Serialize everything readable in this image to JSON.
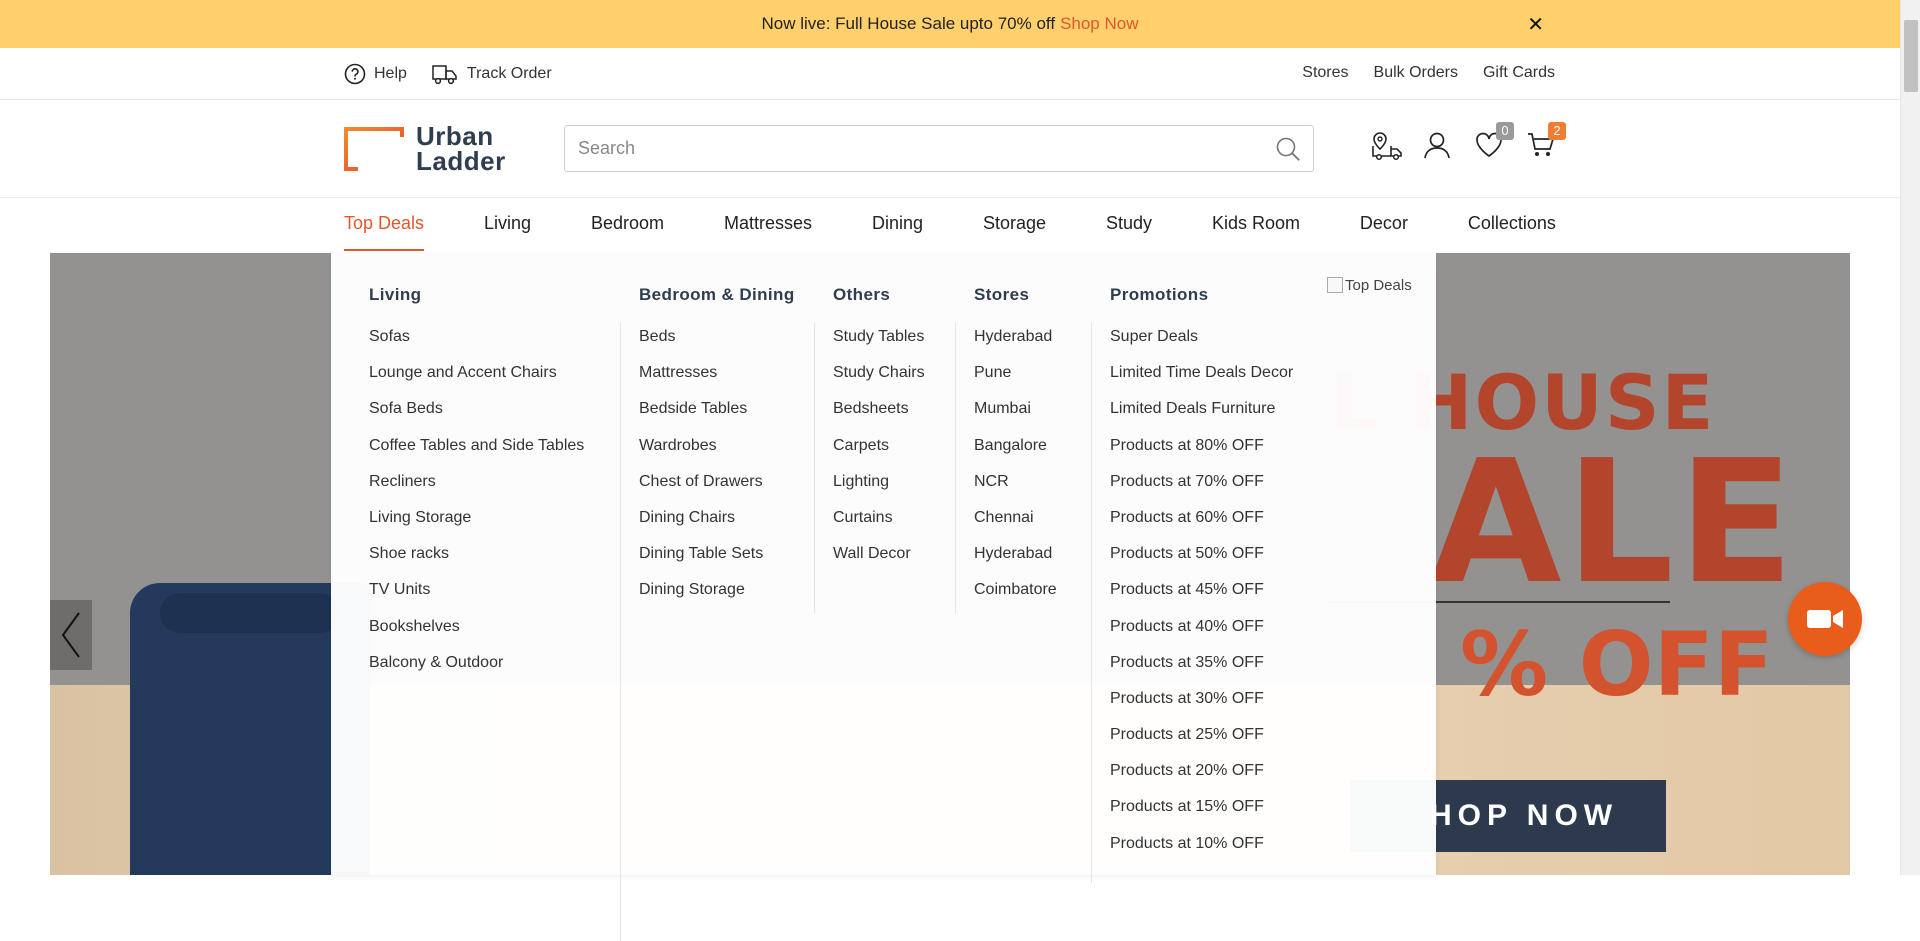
{
  "promo": {
    "text": "Now live: Full House Sale upto 70% off",
    "link": "Shop Now",
    "close": "✕"
  },
  "util": {
    "help": "Help",
    "track": "Track Order",
    "right": [
      "Stores",
      "Bulk Orders",
      "Gift Cards"
    ]
  },
  "header": {
    "logo_line1": "Urban",
    "logo_line2": "Ladder",
    "search_placeholder": "Search",
    "wishlist_count": "0",
    "cart_count": "2"
  },
  "nav": [
    "Top Deals",
    "Living",
    "Bedroom",
    "Mattresses",
    "Dining",
    "Storage",
    "Study",
    "Kids Room",
    "Decor",
    "Collections"
  ],
  "mega": {
    "living": {
      "title": "Living",
      "items": [
        "Sofas",
        "Lounge and Accent Chairs",
        "Sofa Beds",
        "Coffee Tables and Side Tables",
        "Recliners",
        "Living Storage",
        "Shoe racks",
        "TV Units",
        "Bookshelves",
        "Balcony & Outdoor"
      ]
    },
    "bedroom_dining": {
      "title": "Bedroom & Dining",
      "items": [
        "Beds",
        "Mattresses",
        "Bedside Tables",
        "Wardrobes",
        "Chest of Drawers",
        "Dining Chairs",
        "Dining Table Sets",
        "Dining Storage"
      ]
    },
    "others": {
      "title": "Others",
      "items": [
        "Study Tables",
        "Study Chairs",
        "Bedsheets",
        "Carpets",
        "Lighting",
        "Curtains",
        "Wall Decor"
      ]
    },
    "stores": {
      "title": "Stores",
      "items": [
        "Hyderabad",
        "Pune",
        "Mumbai",
        "Bangalore",
        "NCR",
        "Chennai",
        "Hyderabad",
        "Coimbatore"
      ]
    },
    "promotions": {
      "title": "Promotions",
      "items": [
        "Super Deals",
        "Limited Time Deals Decor",
        "Limited Deals Furniture",
        "Products at 80% OFF",
        "Products at 70% OFF",
        "Products at 60% OFF",
        "Products at 50% OFF",
        "Products at 45% OFF",
        "Products at 40% OFF",
        "Products at 35% OFF",
        "Products at 30% OFF",
        "Products at 25% OFF",
        "Products at 20% OFF",
        "Products at 15% OFF",
        "Products at 10% OFF"
      ]
    },
    "image_alt": "Top Deals"
  },
  "banner": {
    "line1": "L HOUSE",
    "line2": "ALE",
    "off": "% OFF",
    "cta": "HOP NOW"
  },
  "colors": {
    "accent": "#e3572d",
    "promo_bg": "#ffd06c",
    "fab": "#e85d1b"
  },
  "icons": [
    "help-circle-icon",
    "truck-icon",
    "search-icon",
    "location-truck-icon",
    "user-icon",
    "heart-icon",
    "cart-icon",
    "chevron-left-icon",
    "video-camera-icon"
  ]
}
